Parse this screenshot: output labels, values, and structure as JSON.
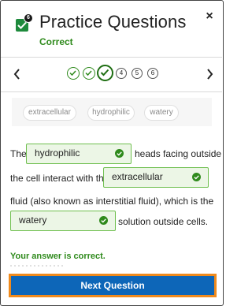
{
  "header": {
    "title": "Practice Questions",
    "status": "Correct",
    "badge_count": "6",
    "close_label": "×"
  },
  "progress": {
    "steps": [
      {
        "state": "done"
      },
      {
        "state": "done"
      },
      {
        "state": "current"
      },
      {
        "state": "pending",
        "label": "4"
      },
      {
        "state": "pending",
        "label": "5"
      },
      {
        "state": "pending",
        "label": "6"
      }
    ]
  },
  "word_bank": [
    "extracellular",
    "hydrophilic",
    "watery"
  ],
  "question": {
    "part1": "The",
    "blank1": "hydrophilic",
    "part2": "heads facing outside",
    "part3": "the cell interact with the",
    "blank2": "extracellular",
    "part4": "fluid (also known as interstitial fluid), which is the",
    "blank3": "watery",
    "part5": "solution outside cells."
  },
  "feedback": "Your answer is correct.",
  "next_button": "Next Question",
  "colors": {
    "accent_green": "#2f8a1c",
    "primary_blue": "#0d66b8",
    "focus_orange": "#f08a1c",
    "blank_fill": "#ecf6e6"
  }
}
